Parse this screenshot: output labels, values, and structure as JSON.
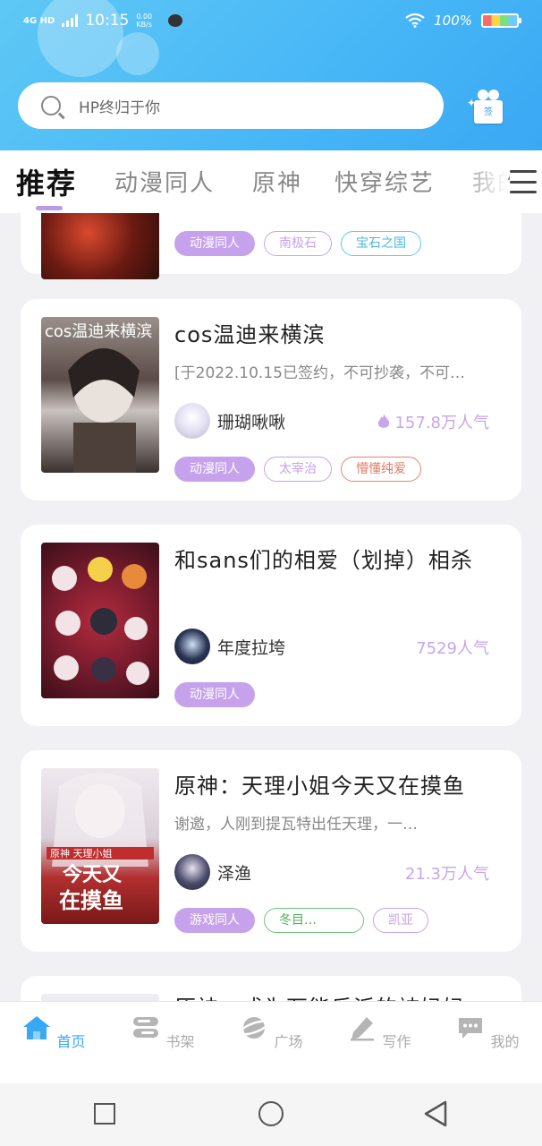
{
  "status": {
    "network": "4G HD",
    "time": "10:15",
    "speed_value": "0.00",
    "speed_unit": "KB/s",
    "battery": "100%"
  },
  "search": {
    "placeholder": "HP终归于你"
  },
  "gift": {
    "label": "签"
  },
  "tabs": [
    "推荐",
    "动漫同人",
    "原神",
    "快穿综艺",
    "我的"
  ],
  "cards": [
    {
      "tags": [
        "动漫同人",
        "南极石",
        "宝石之国"
      ]
    },
    {
      "title": "cos温迪来横滨",
      "desc": "[于2022.10.15已签约，不可抄袭，不可…",
      "author": "珊瑚啾啾",
      "popularity": "157.8万人气",
      "tags": [
        "动漫同人",
        "太宰治",
        "懵懂纯爱"
      ]
    },
    {
      "title": "和sans们的相爱（划掉）相杀",
      "author": "年度拉垮",
      "popularity": "7529人气",
      "tags": [
        "动漫同人"
      ]
    },
    {
      "title": "原神：天理小姐今天又在摸鱼",
      "desc": "谢邀，人刚到提瓦特出任天理，一…",
      "author": "泽渔",
      "popularity": "21.3万人气",
      "tags": [
        "游戏同人",
        "冬目…",
        "凯亚"
      ]
    },
    {
      "title": "原神：成为万能反派的被妈妈"
    }
  ],
  "cover_texts": {
    "card2": "cos温迪来横滨",
    "card4_line1": "原神 天理小姐",
    "card4_line2": "今天又",
    "card4_line3": "在摸鱼"
  },
  "nav": [
    "首页",
    "书架",
    "广场",
    "写作",
    "我的"
  ],
  "colors": {
    "accent": "#3aa8f3",
    "tag_purple": "#c7a2ec",
    "tag_blue": "#5cc9e8",
    "tag_red": "#e8826e",
    "tag_green": "#6cc47a"
  }
}
